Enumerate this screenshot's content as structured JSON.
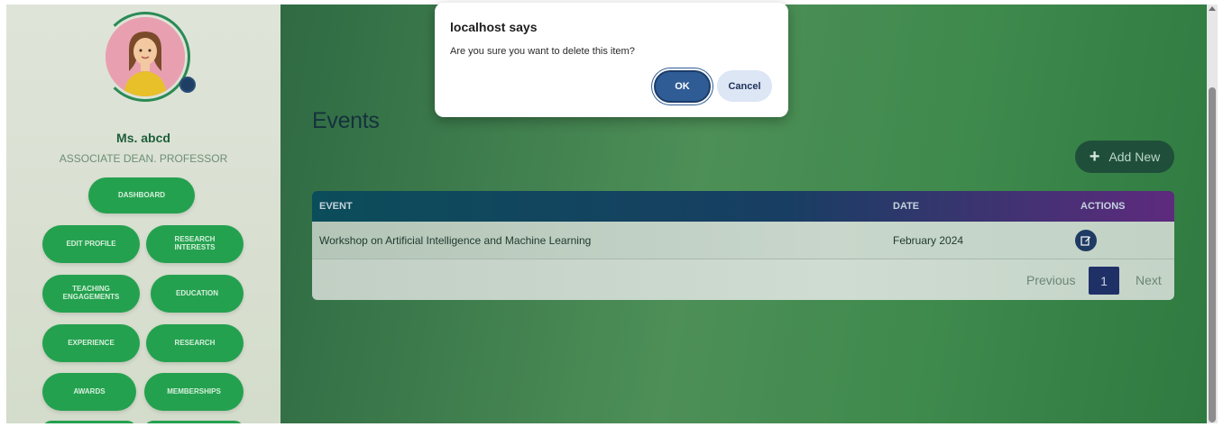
{
  "profile": {
    "name": "Ms. abcd",
    "role": "ASSOCIATE DEAN. PROFESSOR"
  },
  "nav": {
    "dashboard": "DASHBOARD",
    "edit_profile": "EDIT PROFILE",
    "research_interests": "RESEARCH INTERESTS",
    "teaching_engagements": "TEACHING ENGAGEMENTS",
    "education": "EDUCATION",
    "experience": "EXPERIENCE",
    "research": "RESEARCH",
    "awards": "AWARDS",
    "memberships": "MEMBERSHIPS"
  },
  "page": {
    "title": "Events",
    "add_new_label": "Add New",
    "add_icon": "plus-icon"
  },
  "table": {
    "headers": {
      "event": "EVENT",
      "date": "DATE",
      "actions": "ACTIONS"
    },
    "rows": [
      {
        "event": "Workshop on Artificial Intelligence and Machine Learning",
        "date": "February 2024",
        "action_icon": "edit-icon"
      }
    ]
  },
  "pagination": {
    "previous": "Previous",
    "current": "1",
    "next": "Next"
  },
  "dialog": {
    "title": "localhost says",
    "message": "Are you sure you want to delete this item?",
    "ok_label": "OK",
    "cancel_label": "Cancel"
  },
  "colors": {
    "accent_green": "#24a14f",
    "dialog_primary": "#2f5c95",
    "header_start": "#0b4d5a",
    "header_end": "#5e2a7e"
  }
}
